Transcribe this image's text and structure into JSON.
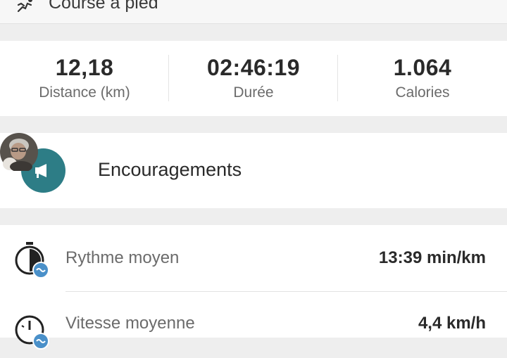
{
  "activity": {
    "label": "Course à pied",
    "icon": "runner-icon"
  },
  "stats": [
    {
      "value": "12,18",
      "label": "Distance (km)"
    },
    {
      "value": "02:46:19",
      "label": "Durée"
    },
    {
      "value": "1.064",
      "label": "Calories"
    }
  ],
  "cheer": {
    "title": "Encouragements",
    "icon": "megaphone-icon",
    "accent": "#2d7d86"
  },
  "metrics": [
    {
      "label": "Rythme moyen",
      "value": "13:39 min/km",
      "icon": "stopwatch-icon"
    },
    {
      "label": "Vitesse moyenne",
      "value": "4,4 km/h",
      "icon": "speedometer-icon"
    }
  ]
}
